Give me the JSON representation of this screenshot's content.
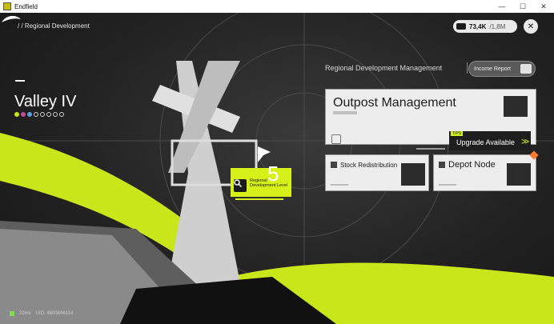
{
  "window": {
    "title": "Endfield"
  },
  "header": {
    "breadcrumb": "/ / Regional Development",
    "resource": {
      "value": "73,4K",
      "cap": "/1,8M"
    },
    "close_glyph": "✕"
  },
  "region": {
    "name": "Valley IV",
    "pips_total": 8,
    "pips_filled": 3
  },
  "development": {
    "level_label": "Regional Development Level",
    "level": "5"
  },
  "panel": {
    "title": "Regional Development Management",
    "income_button": "Income Report",
    "outpost": {
      "title": "Outpost Management",
      "tip_tag": "TIPS",
      "tip_text": "Upgrade Available",
      "tip_glyph": "≫"
    },
    "stock": {
      "title": "Stock Redistribution"
    },
    "depot": {
      "title": "Depot Node"
    }
  },
  "footer": {
    "ping": "22ms",
    "uid": "UID: 4600846114"
  },
  "colors": {
    "accent": "#d6f01a",
    "alert": "#ff7a2e",
    "card": "#ededed"
  }
}
